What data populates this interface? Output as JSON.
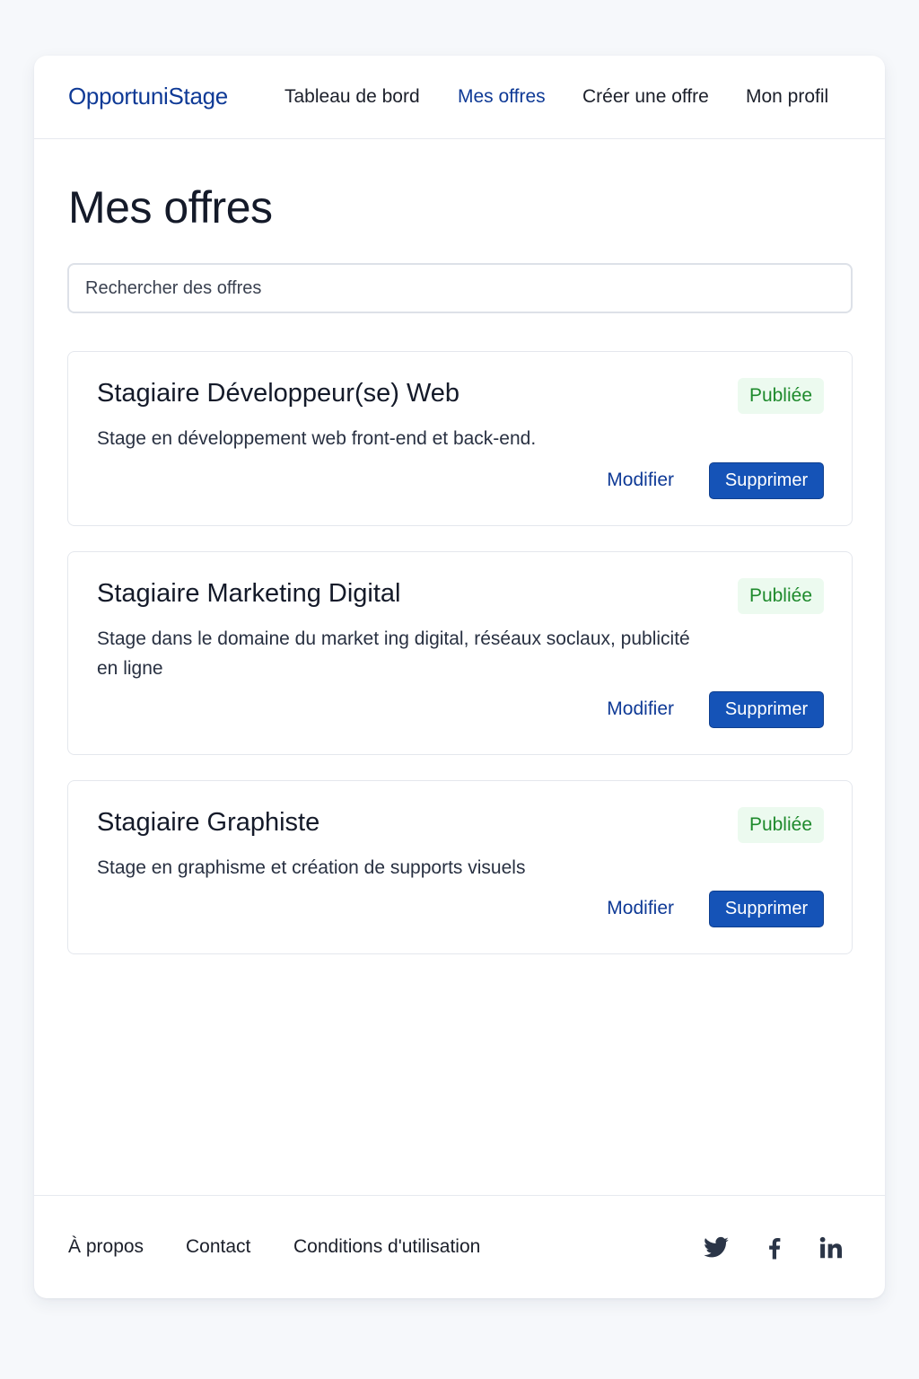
{
  "header": {
    "logo": "OpportuniStage",
    "nav": [
      {
        "label": "Tableau de bord",
        "active": false
      },
      {
        "label": "Mes offres",
        "active": true
      },
      {
        "label": "Créer une offre",
        "active": false
      },
      {
        "label": "Mon profil",
        "active": false
      }
    ]
  },
  "main": {
    "title": "Mes offres",
    "search": {
      "placeholder": "Rechercher des offres",
      "value": ""
    },
    "offers": [
      {
        "title": "Stagiaire Développeur(se) Web",
        "description": "Stage en développement web front-end et back-end.",
        "status": "Publiée",
        "modify_label": "Modifier",
        "delete_label": "Supprimer"
      },
      {
        "title": "Stagiaire Marketing Digital",
        "description": "Stage dans le domaine du market ing digital, réséaux soclaux, publicité en ligne",
        "status": "Publiée",
        "modify_label": "Modifier",
        "delete_label": "Supprimer"
      },
      {
        "title": "Stagiaire Graphiste",
        "description": "Stage en graphisme et création de supports visuels",
        "status": "Publiée",
        "modify_label": "Modifier",
        "delete_label": "Supprimer"
      }
    ]
  },
  "footer": {
    "links": [
      "À propos",
      "Contact",
      "Conditions d'utilisation"
    ],
    "social": [
      "twitter-icon",
      "facebook-icon",
      "linkedin-icon"
    ]
  },
  "colors": {
    "brand": "#0f3a96",
    "primary_button": "#1553b7",
    "status_published_text": "#1e8a2c",
    "status_published_bg": "#ecfaef",
    "page_background": "#f6f8fb"
  }
}
